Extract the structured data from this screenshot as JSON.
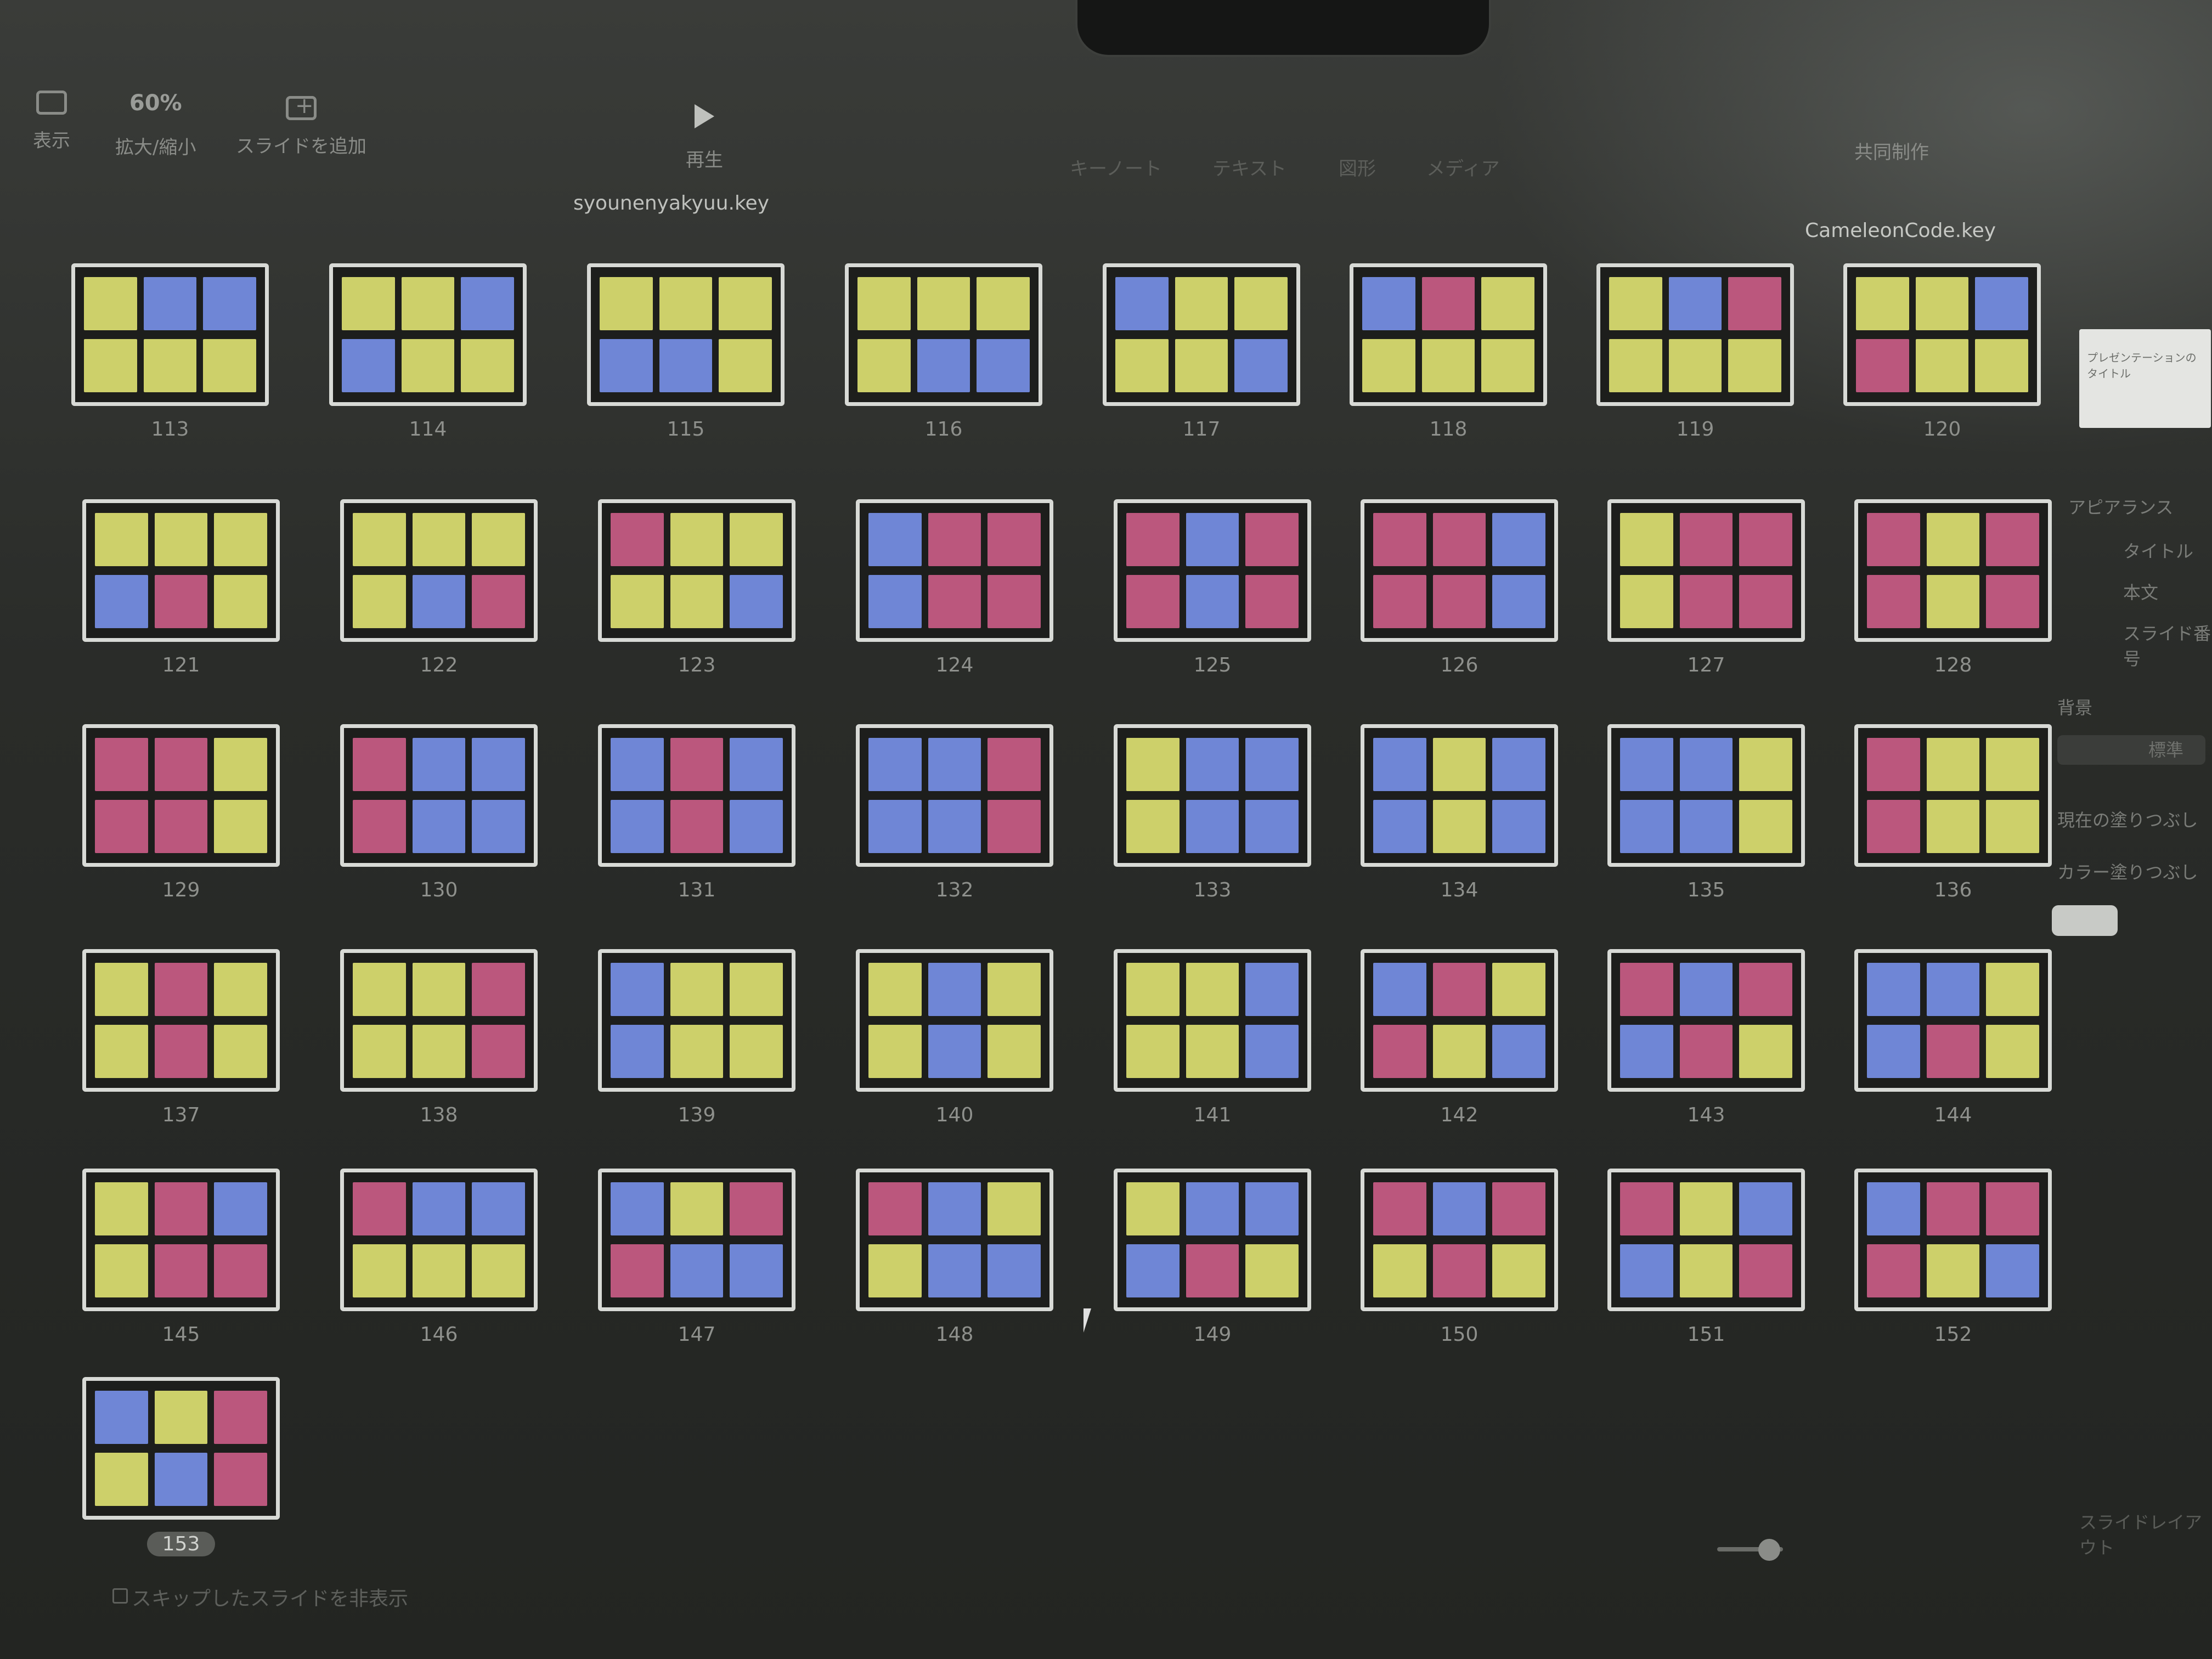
{
  "toolbar": {
    "view_label": "表示",
    "zoom_value": "60%",
    "zoom_label": "拡大/縮小",
    "add_slide_label": "スライドを追加",
    "play_label": "再生",
    "faint_tabs": [
      "キーノート",
      "テキスト",
      "図形",
      "メディア"
    ],
    "collaborate_label": "共同制作"
  },
  "documents": {
    "left_title": "syounenyakyuu.key",
    "right_title": "CameleonCode.key"
  },
  "colors": {
    "Y": "#cdd06a",
    "B": "#6f86d6",
    "P": "#bb577d"
  },
  "slides": [
    {
      "num": "113",
      "cells": [
        "Y",
        "B",
        "B",
        "Y",
        "Y",
        "Y"
      ]
    },
    {
      "num": "114",
      "cells": [
        "Y",
        "Y",
        "B",
        "B",
        "Y",
        "Y"
      ]
    },
    {
      "num": "115",
      "cells": [
        "Y",
        "Y",
        "Y",
        "B",
        "B",
        "Y"
      ]
    },
    {
      "num": "116",
      "cells": [
        "Y",
        "Y",
        "Y",
        "Y",
        "B",
        "B"
      ]
    },
    {
      "num": "117",
      "cells": [
        "B",
        "Y",
        "Y",
        "Y",
        "Y",
        "B"
      ]
    },
    {
      "num": "118",
      "cells": [
        "B",
        "P",
        "Y",
        "Y",
        "Y",
        "Y"
      ]
    },
    {
      "num": "119",
      "cells": [
        "Y",
        "B",
        "P",
        "Y",
        "Y",
        "Y"
      ]
    },
    {
      "num": "120",
      "cells": [
        "Y",
        "Y",
        "B",
        "P",
        "Y",
        "Y"
      ]
    },
    {
      "num": "121",
      "cells": [
        "Y",
        "Y",
        "Y",
        "B",
        "P",
        "Y"
      ]
    },
    {
      "num": "122",
      "cells": [
        "Y",
        "Y",
        "Y",
        "Y",
        "B",
        "P"
      ]
    },
    {
      "num": "123",
      "cells": [
        "P",
        "Y",
        "Y",
        "Y",
        "Y",
        "B"
      ]
    },
    {
      "num": "124",
      "cells": [
        "B",
        "P",
        "P",
        "B",
        "P",
        "P"
      ]
    },
    {
      "num": "125",
      "cells": [
        "P",
        "B",
        "P",
        "P",
        "B",
        "P"
      ]
    },
    {
      "num": "126",
      "cells": [
        "P",
        "P",
        "B",
        "P",
        "P",
        "B"
      ]
    },
    {
      "num": "127",
      "cells": [
        "Y",
        "P",
        "P",
        "Y",
        "P",
        "P"
      ]
    },
    {
      "num": "128",
      "cells": [
        "P",
        "Y",
        "P",
        "P",
        "Y",
        "P"
      ]
    },
    {
      "num": "129",
      "cells": [
        "P",
        "P",
        "Y",
        "P",
        "P",
        "Y"
      ]
    },
    {
      "num": "130",
      "cells": [
        "P",
        "B",
        "B",
        "P",
        "B",
        "B"
      ]
    },
    {
      "num": "131",
      "cells": [
        "B",
        "P",
        "B",
        "B",
        "P",
        "B"
      ]
    },
    {
      "num": "132",
      "cells": [
        "B",
        "B",
        "P",
        "B",
        "B",
        "P"
      ]
    },
    {
      "num": "133",
      "cells": [
        "Y",
        "B",
        "B",
        "Y",
        "B",
        "B"
      ]
    },
    {
      "num": "134",
      "cells": [
        "B",
        "Y",
        "B",
        "B",
        "Y",
        "B"
      ]
    },
    {
      "num": "135",
      "cells": [
        "B",
        "B",
        "Y",
        "B",
        "B",
        "Y"
      ]
    },
    {
      "num": "136",
      "cells": [
        "P",
        "Y",
        "Y",
        "P",
        "Y",
        "Y"
      ]
    },
    {
      "num": "137",
      "cells": [
        "Y",
        "P",
        "Y",
        "Y",
        "P",
        "Y"
      ]
    },
    {
      "num": "138",
      "cells": [
        "Y",
        "Y",
        "P",
        "Y",
        "Y",
        "P"
      ]
    },
    {
      "num": "139",
      "cells": [
        "B",
        "Y",
        "Y",
        "B",
        "Y",
        "Y"
      ]
    },
    {
      "num": "140",
      "cells": [
        "Y",
        "B",
        "Y",
        "Y",
        "B",
        "Y"
      ]
    },
    {
      "num": "141",
      "cells": [
        "Y",
        "Y",
        "B",
        "Y",
        "Y",
        "B"
      ]
    },
    {
      "num": "142",
      "cells": [
        "B",
        "P",
        "Y",
        "P",
        "Y",
        "B"
      ]
    },
    {
      "num": "143",
      "cells": [
        "P",
        "B",
        "P",
        "B",
        "P",
        "Y"
      ]
    },
    {
      "num": "144",
      "cells": [
        "B",
        "B",
        "Y",
        "B",
        "P",
        "Y"
      ]
    },
    {
      "num": "145",
      "cells": [
        "Y",
        "P",
        "B",
        "Y",
        "P",
        "P"
      ]
    },
    {
      "num": "146",
      "cells": [
        "P",
        "B",
        "B",
        "Y",
        "Y",
        "Y"
      ]
    },
    {
      "num": "147",
      "cells": [
        "B",
        "Y",
        "P",
        "P",
        "B",
        "B"
      ]
    },
    {
      "num": "148",
      "cells": [
        "P",
        "B",
        "Y",
        "Y",
        "B",
        "B"
      ]
    },
    {
      "num": "149",
      "cells": [
        "Y",
        "B",
        "B",
        "B",
        "P",
        "Y"
      ]
    },
    {
      "num": "150",
      "cells": [
        "P",
        "B",
        "P",
        "Y",
        "P",
        "Y"
      ]
    },
    {
      "num": "151",
      "cells": [
        "P",
        "Y",
        "B",
        "B",
        "Y",
        "P"
      ]
    },
    {
      "num": "152",
      "cells": [
        "B",
        "P",
        "P",
        "P",
        "Y",
        "B"
      ]
    },
    {
      "num": "153",
      "cells": [
        "B",
        "Y",
        "P",
        "Y",
        "B",
        "P"
      ]
    }
  ],
  "selected_slide": "153",
  "inspector": {
    "theme_title": "プレゼンテーションのタイトル",
    "appearance_label": "アピアランス",
    "title_label": "タイトル",
    "body_label": "本文",
    "slide_number_label": "スライド番号",
    "background_label": "背景",
    "background_value": "標準",
    "current_fill_label": "現在の塗りつぶし",
    "color_fill_label": "カラー塗りつぶし"
  },
  "footer": {
    "skip_label": "スキップしたスライドを非表示",
    "slide_layout_label": "スライドレイアウト"
  }
}
